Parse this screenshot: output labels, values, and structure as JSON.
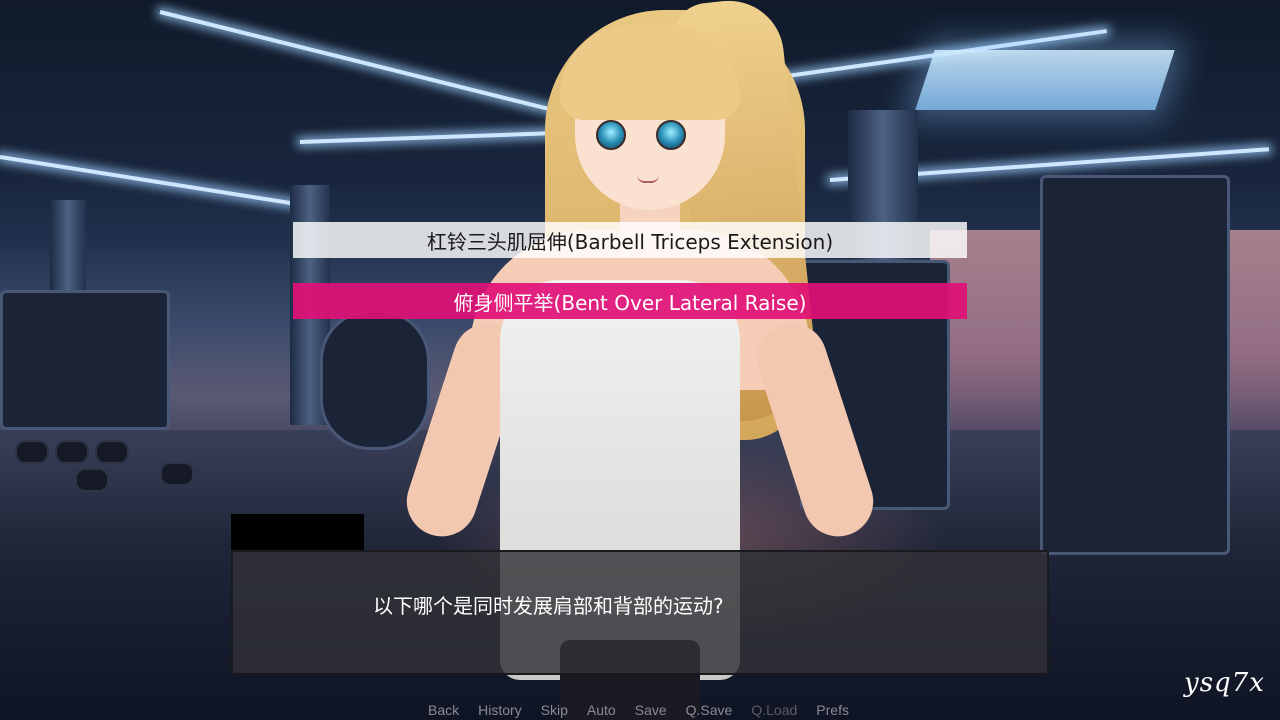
{
  "choices": [
    {
      "label": "杠铃三头肌屈伸(Barbell Triceps Extension)",
      "state": "idle"
    },
    {
      "label": "俯身侧平举(Bent Over Lateral Raise)",
      "state": "hover"
    }
  ],
  "dialogue": {
    "speaker": "",
    "text": "以下哪个是同时发展肩部和背部的运动?"
  },
  "quick_menu": [
    {
      "label": "Back"
    },
    {
      "label": "History"
    },
    {
      "label": "Skip"
    },
    {
      "label": "Auto"
    },
    {
      "label": "Save"
    },
    {
      "label": "Q.Save"
    },
    {
      "label": "Q.Load"
    },
    {
      "label": "Prefs"
    }
  ],
  "watermark": "ysq7x",
  "colors": {
    "choice_hover": "#e01076",
    "choice_idle": "#ffffff",
    "textbox": "#323237",
    "quick_menu_text": "#8a8a94"
  }
}
